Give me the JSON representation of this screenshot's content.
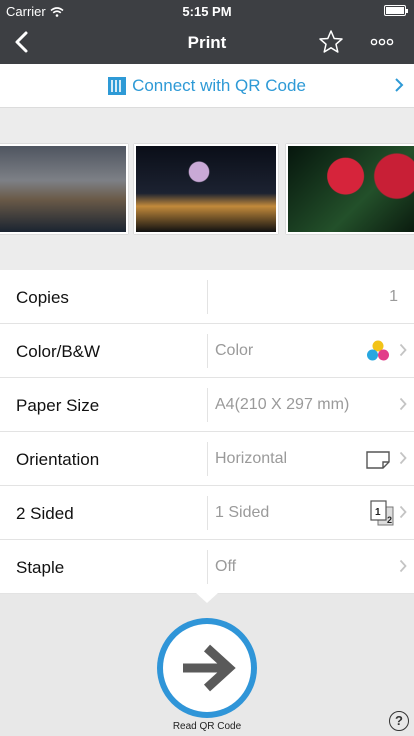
{
  "status": {
    "carrier": "Carrier",
    "time": "5:15 PM"
  },
  "nav": {
    "title": "Print",
    "back_icon": "chevron-left-icon",
    "favorite_icon": "star-icon",
    "more_icon": "more-dots-icon"
  },
  "qr": {
    "label": "Connect with QR Code",
    "icon": "qr-code-icon",
    "color": "#2e9ad6"
  },
  "settings": {
    "copies": {
      "label": "Copies",
      "value": "1"
    },
    "color": {
      "label": "Color/B&W",
      "value": "Color"
    },
    "paper": {
      "label": "Paper Size",
      "value": "A4(210 X 297 mm)"
    },
    "orientation": {
      "label": "Orientation",
      "value": "Horizontal"
    },
    "sided": {
      "label": "2 Sided",
      "value": "1 Sided",
      "icon_num1": "1",
      "icon_num2": "2"
    },
    "staple": {
      "label": "Staple",
      "value": "Off"
    }
  },
  "bottom": {
    "button_label": "Read QR Code",
    "help": "?"
  },
  "colors": {
    "nav_bg": "#3d3f43",
    "accent": "#2f95d8"
  }
}
